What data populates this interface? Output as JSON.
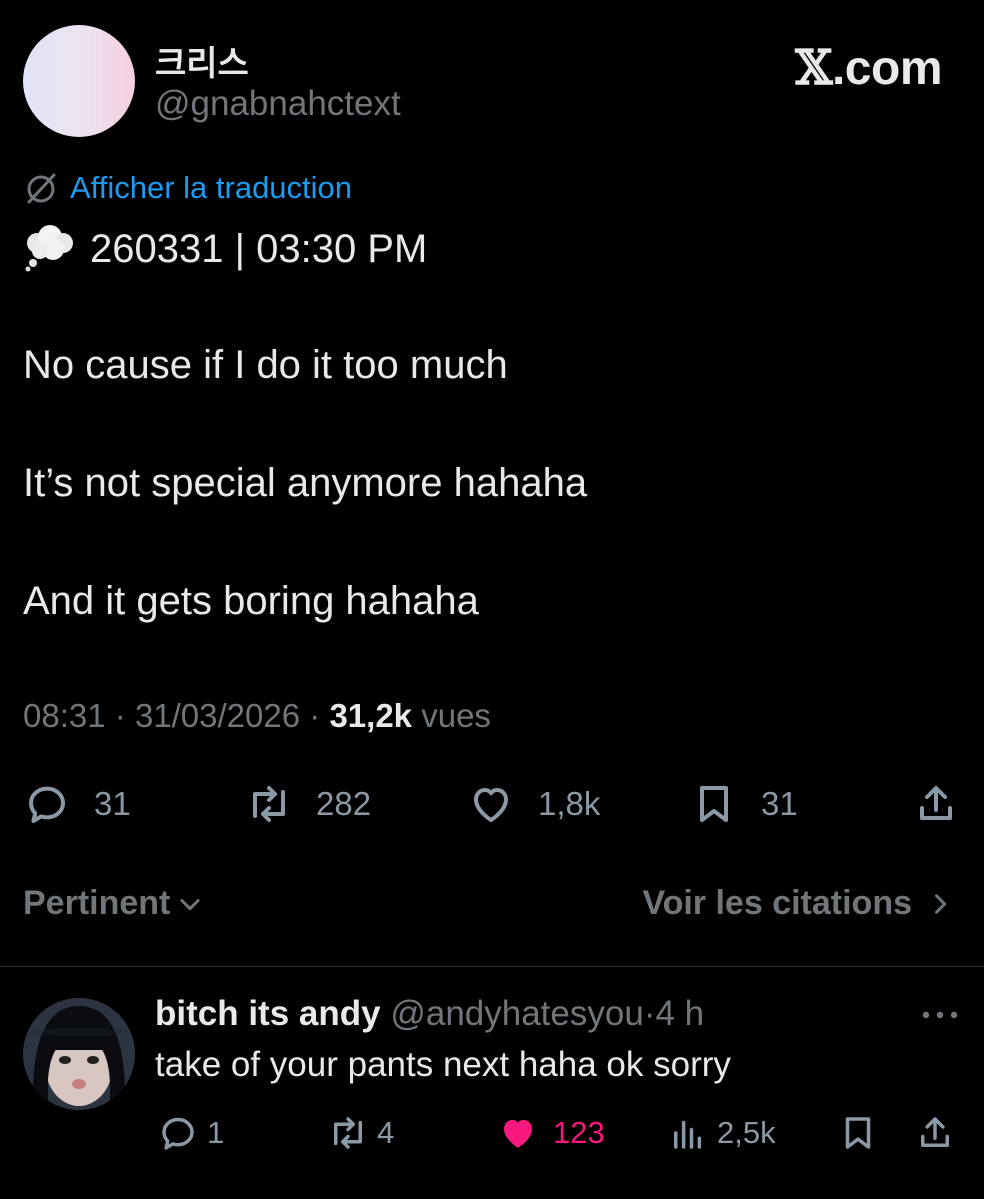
{
  "brand": {
    "logo_letter": "𝕏",
    "suffix": ".com"
  },
  "author": {
    "display_name": "크리스",
    "handle": "@gnabnahctext"
  },
  "translate": {
    "label": "Afficher la traduction",
    "icon": "translate-globe-icon"
  },
  "tweet": {
    "emoji": "thought-balloon-icon",
    "date_line": "260331 | 03:30 PM",
    "lines": [
      "No cause if I do it too much",
      "It’s not special anymore hahaha",
      "And it gets boring hahaha"
    ],
    "time": "08:31",
    "sep": "·",
    "date": "31/03/2026",
    "views_count": "31,2k",
    "views_label": "vues"
  },
  "actions": {
    "replies": "31",
    "reposts": "282",
    "likes": "1,8k",
    "bookmarks": "31"
  },
  "sort": {
    "label": "Pertinent",
    "quotes_label": "Voir les citations"
  },
  "reply": {
    "name": "bitch its andy",
    "handle": "@andyhatesyou",
    "sep": "·",
    "time": "4 h",
    "text": "take of your pants next haha ok sorry",
    "replies": "1",
    "reposts": "4",
    "likes": "123",
    "views": "2,5k",
    "like_color": "#f91880"
  },
  "colors": {
    "accent": "#1d9bf0",
    "muted": "#71767b",
    "text": "#e7e9ea",
    "like": "#f91880"
  }
}
